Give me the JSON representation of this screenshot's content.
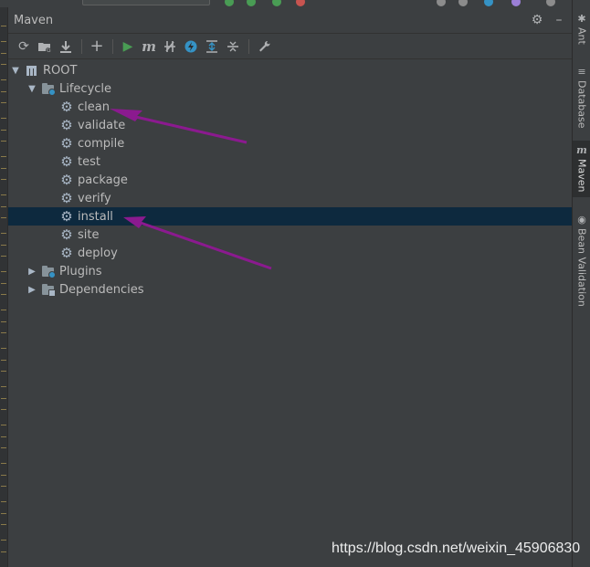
{
  "panel": {
    "title": "Maven"
  },
  "tree": {
    "root": {
      "label": "ROOT"
    },
    "lifecycle": {
      "label": "Lifecycle",
      "phases": [
        "clean",
        "validate",
        "compile",
        "test",
        "package",
        "verify",
        "install",
        "site",
        "deploy"
      ],
      "selected": "install"
    },
    "plugins": {
      "label": "Plugins"
    },
    "dependencies": {
      "label": "Dependencies"
    }
  },
  "sidebar": {
    "tabs": [
      {
        "label": "Ant",
        "icon": "ant-icon"
      },
      {
        "label": "Database",
        "icon": "database-icon"
      },
      {
        "label": "Maven",
        "icon": "maven-icon",
        "active": true
      },
      {
        "label": "Bean Validation",
        "icon": "bean-validation-icon"
      }
    ]
  },
  "watermark": "https://blog.csdn.net/weixin_45906830",
  "colors": {
    "background": "#3c3f41",
    "selection": "#0d293e",
    "annotation_arrow": "#8b1a8f",
    "run_green": "#499c54",
    "accent_blue": "#3592c4"
  }
}
